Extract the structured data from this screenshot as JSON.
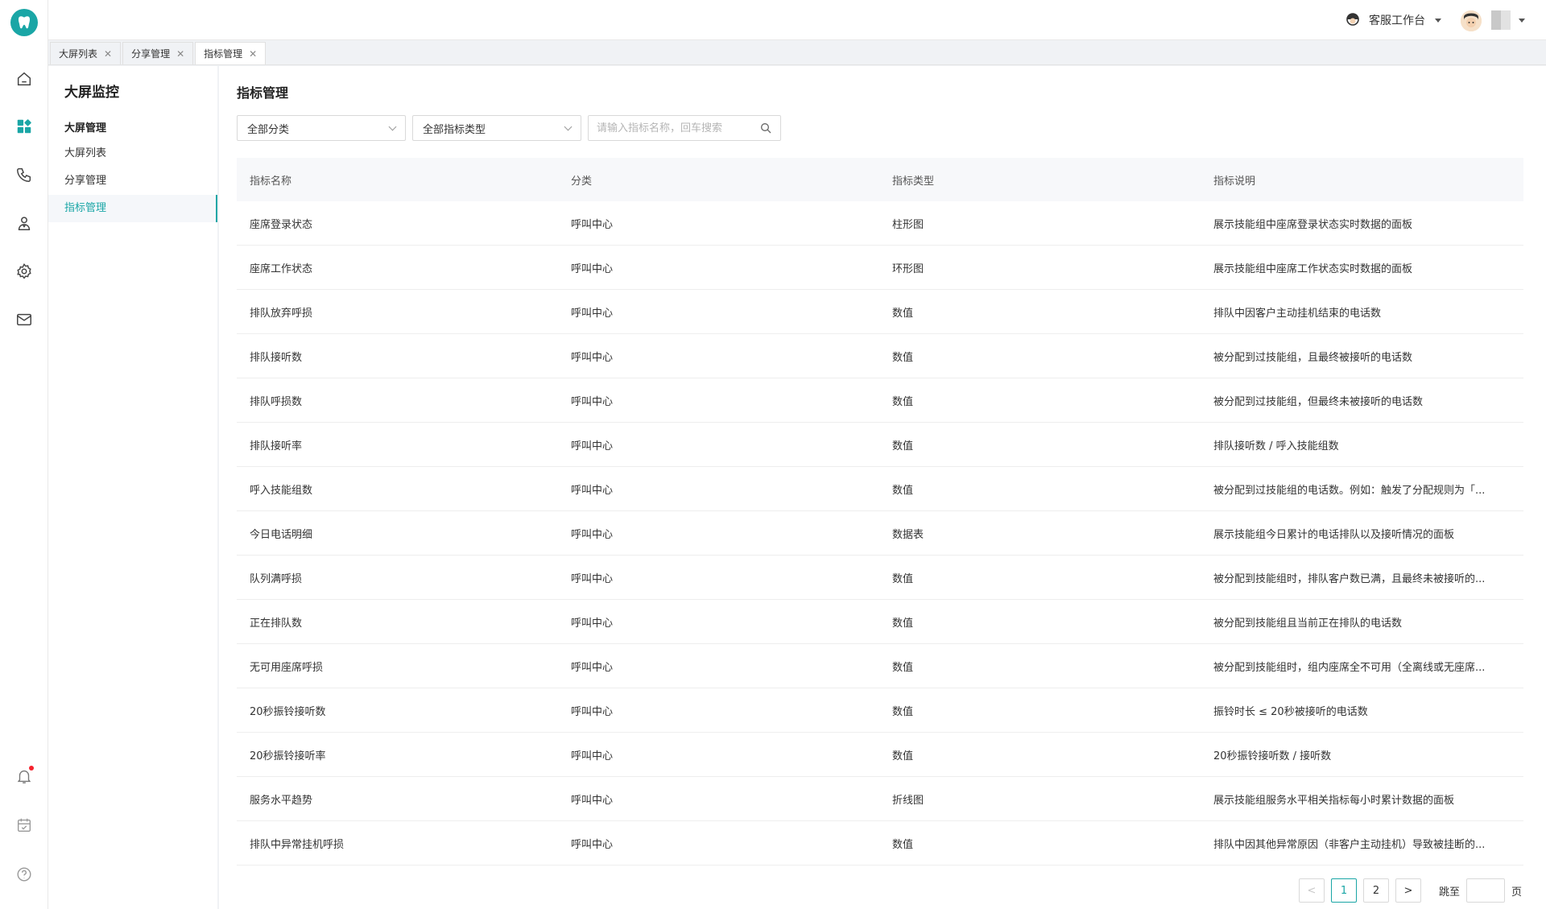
{
  "header": {
    "workbench_label": "客服工作台"
  },
  "tabs": [
    {
      "label": "大屏列表",
      "active": false
    },
    {
      "label": "分享管理",
      "active": false
    },
    {
      "label": "指标管理",
      "active": true
    }
  ],
  "subnav": {
    "title": "大屏监控",
    "group_label": "大屏管理",
    "items": [
      {
        "label": "大屏列表",
        "active": false
      },
      {
        "label": "分享管理",
        "active": false
      },
      {
        "label": "指标管理",
        "active": true
      }
    ]
  },
  "main": {
    "title": "指标管理",
    "filters": {
      "category": "全部分类",
      "indicator_type": "全部指标类型",
      "search_placeholder": "请输入指标名称，回车搜索"
    },
    "table": {
      "columns": [
        "指标名称",
        "分类",
        "指标类型",
        "指标说明"
      ],
      "rows": [
        [
          "座席登录状态",
          "呼叫中心",
          "柱形图",
          "展示技能组中座席登录状态实时数据的面板"
        ],
        [
          "座席工作状态",
          "呼叫中心",
          "环形图",
          "展示技能组中座席工作状态实时数据的面板"
        ],
        [
          "排队放弃呼损",
          "呼叫中心",
          "数值",
          "排队中因客户主动挂机结束的电话数"
        ],
        [
          "排队接听数",
          "呼叫中心",
          "数值",
          "被分配到过技能组，且最终被接听的电话数"
        ],
        [
          "排队呼损数",
          "呼叫中心",
          "数值",
          "被分配到过技能组，但最终未被接听的电话数"
        ],
        [
          "排队接听率",
          "呼叫中心",
          "数值",
          "排队接听数 / 呼入技能组数"
        ],
        [
          "呼入技能组数",
          "呼叫中心",
          "数值",
          "被分配到过技能组的电话数。例如：触发了分配规则为「..."
        ],
        [
          "今日电话明细",
          "呼叫中心",
          "数据表",
          "展示技能组今日累计的电话排队以及接听情况的面板"
        ],
        [
          "队列满呼损",
          "呼叫中心",
          "数值",
          "被分配到技能组时，排队客户数已满，且最终未被接听的..."
        ],
        [
          "正在排队数",
          "呼叫中心",
          "数值",
          "被分配到技能组且当前正在排队的电话数"
        ],
        [
          "无可用座席呼损",
          "呼叫中心",
          "数值",
          "被分配到技能组时，组内座席全不可用（全离线或无座席..."
        ],
        [
          "20秒振铃接听数",
          "呼叫中心",
          "数值",
          "振铃时长 ≤ 20秒被接听的电话数"
        ],
        [
          "20秒振铃接听率",
          "呼叫中心",
          "数值",
          "20秒振铃接听数 / 接听数"
        ],
        [
          "服务水平趋势",
          "呼叫中心",
          "折线图",
          "展示技能组服务水平相关指标每小时累计数据的面板"
        ],
        [
          "排队中异常挂机呼损",
          "呼叫中心",
          "数值",
          "排队中因其他异常原因（非客户主动挂机）导致被挂断的..."
        ]
      ]
    },
    "pagination": {
      "prev": "<",
      "next": ">",
      "pages": [
        "1",
        "2"
      ],
      "current": "1",
      "jump_label": "跳至",
      "page_suffix": "页"
    }
  },
  "colors": {
    "accent": "#1aa6a6",
    "notification_dot": "#f5222d"
  }
}
